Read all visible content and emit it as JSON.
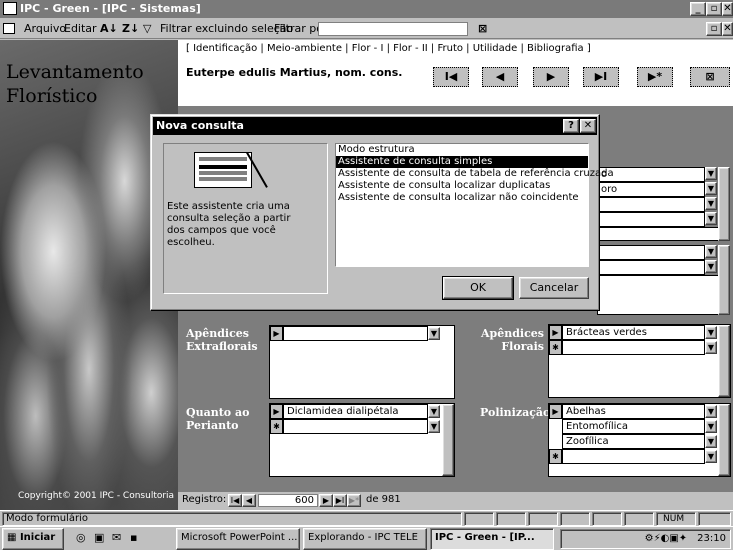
{
  "app": {
    "title": "IPC - Green - [IPC - Sistemas]"
  },
  "menu": {
    "items": [
      "Arquivo",
      "Editar",
      "Filtrar excluindo seleção",
      "Filtrar por"
    ],
    "filter_icon": "funnel-x-icon"
  },
  "sidebar": {
    "title_line1": "Levantamento",
    "title_line2": "Florístico",
    "copyright": "Copyright© 2001  IPC - Consultoria"
  },
  "tabs": {
    "text": "[ Identificação | Meio-ambiente | Flor - I | Flor - II | Fruto | Utilidade | Bibliografia ]"
  },
  "species": {
    "name": "Euterpe edulis Martius, nom. cons."
  },
  "nav": {
    "first": "⏮",
    "prev": "◀",
    "next": "▶",
    "last": "⏭",
    "new": "▶*",
    "exit": "⊠"
  },
  "dialog": {
    "title": "Nova consulta",
    "description": "Este assistente cria uma consulta seleção a partir dos campos que você escolheu.",
    "options": [
      "Modo estrutura",
      "Assistente de consulta simples",
      "Assistente de consulta de tabela de referência cruzada",
      "Assistente de consulta localizar duplicatas",
      "Assistente de consulta localizar não coincidente"
    ],
    "selected_index": 1,
    "ok": "OK",
    "cancel": "Cancelar",
    "help": "?",
    "close": "✕"
  },
  "partial": {
    "field1": "o",
    "field2": "oro"
  },
  "form": {
    "apendices_extraflorais_label": "Apêndices Extraflorais",
    "apendices_florais_label": "Apêndices Florais",
    "apendices_florais_values": [
      "Brácteas verdes"
    ],
    "quanto_perianto_label": "Quanto ao Perianto",
    "quanto_perianto_values": [
      "Diclamidea dialipétala"
    ],
    "polinizacao_label": "Polinização",
    "polinizacao_values": [
      "Abelhas",
      "Entomofílica",
      "Zoofílica"
    ]
  },
  "record": {
    "label": "Registro:",
    "current": "600",
    "of": "de 981"
  },
  "status": {
    "mode": "Modo formulário",
    "num": "NUM"
  },
  "taskbar": {
    "start": "Iniciar",
    "items": [
      "Microsoft PowerPoint ...",
      "Explorando - IPC TELE",
      "IPC - Green - [IP..."
    ],
    "clock": "23:10"
  }
}
